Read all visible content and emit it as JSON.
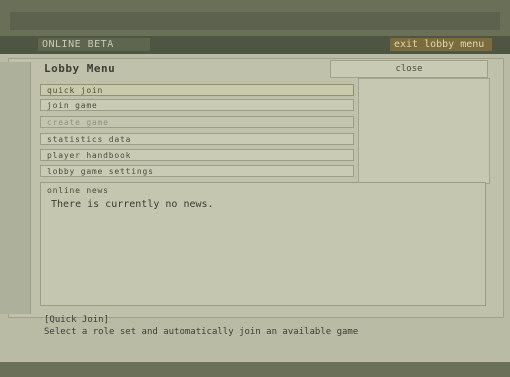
{
  "top": {
    "left_tab": "ONLINE BETA",
    "right_tab": "exit lobby menu"
  },
  "panel": {
    "title": "Lobby Menu",
    "side_button": "close"
  },
  "menu_items": [
    "quick join",
    "join game",
    "create game",
    "statistics data",
    "player handbook",
    "lobby game settings"
  ],
  "news": {
    "label": "online news",
    "message": "There is currently no news."
  },
  "hint": {
    "line1": "[Quick Join]",
    "line2": "Select a role set and automatically join an available game"
  }
}
